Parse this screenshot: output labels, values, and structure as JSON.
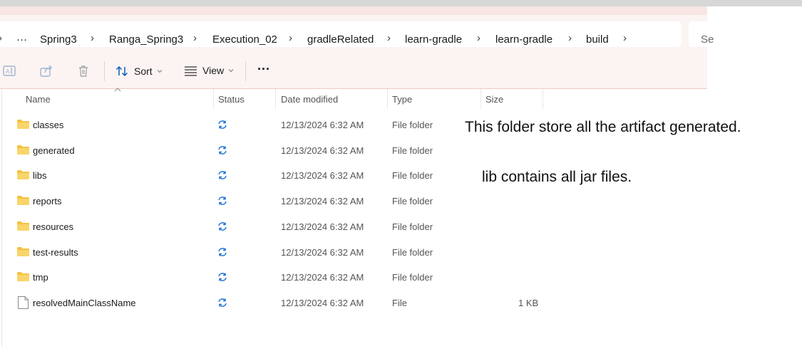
{
  "breadcrumb": {
    "more": "···",
    "items": [
      "Spring3",
      "Ranga_Spring3",
      "Execution_02",
      "gradleRelated",
      "learn-gradle",
      "learn-gradle",
      "build"
    ],
    "separator": "›"
  },
  "search": {
    "placeholder": "Se"
  },
  "toolbar": {
    "sort_label": "Sort",
    "view_label": "View",
    "more_label": "···",
    "accent": "#0b5cbd"
  },
  "columns": {
    "name": "Name",
    "status": "Status",
    "date": "Date modified",
    "type": "Type",
    "size": "Size"
  },
  "rows": [
    {
      "name": "classes",
      "date": "12/13/2024 6:32 AM",
      "type": "File folder",
      "size": "",
      "kind": "folder"
    },
    {
      "name": "generated",
      "date": "12/13/2024 6:32 AM",
      "type": "File folder",
      "size": "",
      "kind": "folder"
    },
    {
      "name": "libs",
      "date": "12/13/2024 6:32 AM",
      "type": "File folder",
      "size": "",
      "kind": "folder"
    },
    {
      "name": "reports",
      "date": "12/13/2024 6:32 AM",
      "type": "File folder",
      "size": "",
      "kind": "folder"
    },
    {
      "name": "resources",
      "date": "12/13/2024 6:32 AM",
      "type": "File folder",
      "size": "",
      "kind": "folder"
    },
    {
      "name": "test-results",
      "date": "12/13/2024 6:32 AM",
      "type": "File folder",
      "size": "",
      "kind": "folder"
    },
    {
      "name": "tmp",
      "date": "12/13/2024 6:32 AM",
      "type": "File folder",
      "size": "",
      "kind": "folder"
    },
    {
      "name": "resolvedMainClassName",
      "date": "12/13/2024 6:32 AM",
      "type": "File",
      "size": "1 KB",
      "kind": "file"
    }
  ],
  "notes": {
    "build_note": "This folder store all the artifact generated.",
    "lib_note": "lib contains all jar files."
  },
  "colors": {
    "folder": "#f4c343",
    "sync": "#1a6fd6",
    "toolbar_bg": "#fbf4f3"
  }
}
